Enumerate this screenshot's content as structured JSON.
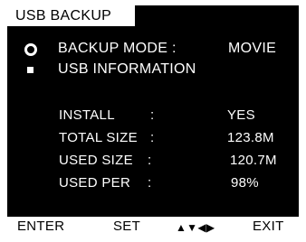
{
  "window": {
    "title": "USB BACKUP"
  },
  "menu": {
    "backup_mode": {
      "label": "BACKUP MODE :",
      "value": "MOVIE",
      "icon": "radio-selected-icon"
    },
    "usb_information": {
      "label": "USB INFORMATION",
      "icon": "square-bullet-icon"
    }
  },
  "info": {
    "install": {
      "label": "INSTALL",
      "colon": ":",
      "value": "YES"
    },
    "total_size": {
      "label": "TOTAL SIZE",
      "colon": ":",
      "value": "123.8M"
    },
    "used_size": {
      "label": "USED SIZE",
      "colon": ":",
      "value": "120.7M"
    },
    "used_per": {
      "label": "USED PER",
      "colon": ":",
      "value": "98%"
    }
  },
  "footer": {
    "enter": "ENTER",
    "set": "SET",
    "arrows": "▲▼◀▶",
    "exit": "EXIT"
  },
  "colors": {
    "background": "#000000",
    "foreground": "#ffffff",
    "bar": "#ffffff"
  }
}
